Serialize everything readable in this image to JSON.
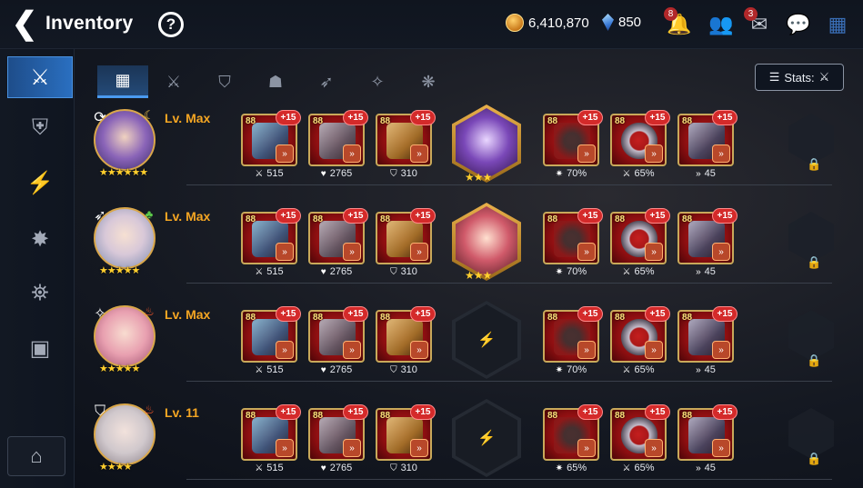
{
  "header": {
    "title": "Inventory",
    "back_glyph": "❮",
    "help_glyph": "?",
    "gold": "6,410,870",
    "crystals": "850",
    "notif_badge": "8",
    "mail_badge": "3"
  },
  "sidebar": {
    "items": [
      {
        "name": "gear-icon-sidebar",
        "glyph": "⚔",
        "active": true
      },
      {
        "name": "artifact-icon",
        "glyph": "⛨",
        "active": false
      },
      {
        "name": "lightning-icon",
        "glyph": "⚡",
        "active": false
      },
      {
        "name": "material-icon",
        "glyph": "✸",
        "active": false
      },
      {
        "name": "bag-icon",
        "glyph": "⛯",
        "active": false
      },
      {
        "name": "chest-icon",
        "glyph": "▣",
        "active": false
      }
    ],
    "storage_glyph": "⌂"
  },
  "tabs": [
    {
      "name": "tab-all",
      "glyph": "▦",
      "active": true
    },
    {
      "name": "tab-weapon",
      "glyph": "⚔",
      "active": false
    },
    {
      "name": "tab-armor",
      "glyph": "⛉",
      "active": false
    },
    {
      "name": "tab-helm",
      "glyph": "☗",
      "active": false
    },
    {
      "name": "tab-bow",
      "glyph": "➶",
      "active": false
    },
    {
      "name": "tab-mage",
      "glyph": "✧",
      "active": false
    },
    {
      "name": "tab-rune",
      "glyph": "❋",
      "active": false
    }
  ],
  "stats_button": {
    "label": "Stats:",
    "icon": "⚔"
  },
  "heroes": [
    {
      "level": "Lv. Max",
      "stars": "★★★★★★",
      "class_glyph": "⟳",
      "elem_glyph": "☾",
      "elem_color": "#f0c24a",
      "gear": [
        {
          "lv": "88",
          "plus": "+15",
          "stat_icon": "⚔",
          "stat": "515",
          "art": "weapon"
        },
        {
          "lv": "88",
          "plus": "+15",
          "stat_icon": "♥",
          "stat": "2765",
          "art": "helm"
        },
        {
          "lv": "88",
          "plus": "+15",
          "stat_icon": "⛉",
          "stat": "310",
          "art": "armor"
        },
        {
          "lv": "88",
          "plus": "+15",
          "stat_icon": "✷",
          "stat": "70%",
          "art": "neck"
        },
        {
          "lv": "88",
          "plus": "+15",
          "stat_icon": "⚔",
          "stat": "65%",
          "art": "ring"
        },
        {
          "lv": "88",
          "plus": "+15",
          "stat_icon": "»",
          "stat": "45",
          "art": "boots"
        }
      ],
      "artifact": {
        "stars": "★★★",
        "filled": true,
        "variant": "a1"
      }
    },
    {
      "level": "Lv. Max",
      "stars": "★★★★★",
      "class_glyph": "➶",
      "elem_glyph": "♣",
      "elem_color": "#5cc94a",
      "gear": [
        {
          "lv": "88",
          "plus": "+15",
          "stat_icon": "⚔",
          "stat": "515",
          "art": "weapon"
        },
        {
          "lv": "88",
          "plus": "+15",
          "stat_icon": "♥",
          "stat": "2765",
          "art": "helm"
        },
        {
          "lv": "88",
          "plus": "+15",
          "stat_icon": "⛉",
          "stat": "310",
          "art": "armor"
        },
        {
          "lv": "88",
          "plus": "+15",
          "stat_icon": "✷",
          "stat": "70%",
          "art": "neck"
        },
        {
          "lv": "88",
          "plus": "+15",
          "stat_icon": "⚔",
          "stat": "65%",
          "art": "ring"
        },
        {
          "lv": "88",
          "plus": "+15",
          "stat_icon": "»",
          "stat": "45",
          "art": "boots"
        }
      ],
      "artifact": {
        "stars": "★★★",
        "filled": true,
        "variant": "a2"
      }
    },
    {
      "level": "Lv. Max",
      "stars": "★★★★★",
      "class_glyph": "✧",
      "elem_glyph": "♨",
      "elem_color": "#ff5a2a",
      "gear": [
        {
          "lv": "88",
          "plus": "+15",
          "stat_icon": "⚔",
          "stat": "515",
          "art": "weapon"
        },
        {
          "lv": "88",
          "plus": "+15",
          "stat_icon": "♥",
          "stat": "2765",
          "art": "helm"
        },
        {
          "lv": "88",
          "plus": "+15",
          "stat_icon": "⛉",
          "stat": "310",
          "art": "armor"
        },
        {
          "lv": "88",
          "plus": "+15",
          "stat_icon": "✷",
          "stat": "70%",
          "art": "neck"
        },
        {
          "lv": "88",
          "plus": "+15",
          "stat_icon": "⚔",
          "stat": "65%",
          "art": "ring"
        },
        {
          "lv": "88",
          "plus": "+15",
          "stat_icon": "»",
          "stat": "45",
          "art": "boots"
        }
      ],
      "artifact": {
        "stars": "",
        "filled": false,
        "variant": "empty"
      }
    },
    {
      "level": "Lv. 11",
      "stars": "★★★★",
      "class_glyph": "⛉",
      "elem_glyph": "♨",
      "elem_color": "#ff5a2a",
      "gear": [
        {
          "lv": "88",
          "plus": "+15",
          "stat_icon": "⚔",
          "stat": "515",
          "art": "weapon"
        },
        {
          "lv": "88",
          "plus": "+15",
          "stat_icon": "♥",
          "stat": "2765",
          "art": "helm"
        },
        {
          "lv": "88",
          "plus": "+15",
          "stat_icon": "⛉",
          "stat": "310",
          "art": "armor"
        },
        {
          "lv": "88",
          "plus": "+15",
          "stat_icon": "✷",
          "stat": "65%",
          "art": "neck"
        },
        {
          "lv": "88",
          "plus": "+15",
          "stat_icon": "⚔",
          "stat": "65%",
          "art": "ring"
        },
        {
          "lv": "88",
          "plus": "+15",
          "stat_icon": "»",
          "stat": "45",
          "art": "boots"
        }
      ],
      "artifact": {
        "stars": "",
        "filled": false,
        "variant": "empty"
      }
    }
  ],
  "lock_glyph": "🔒"
}
